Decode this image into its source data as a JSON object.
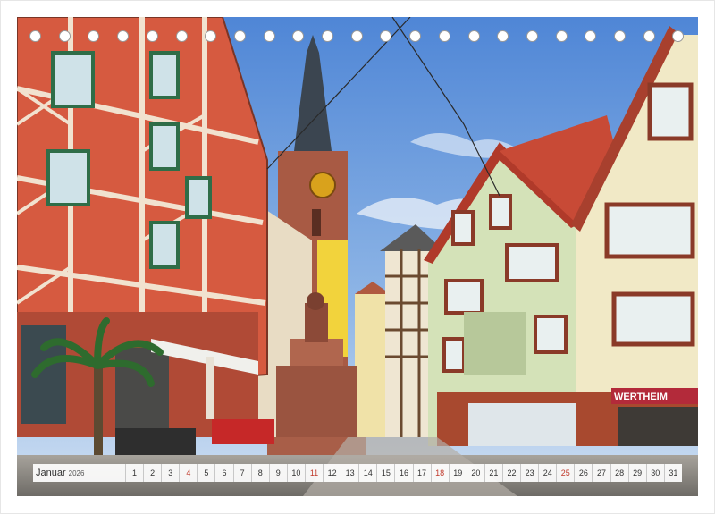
{
  "calendar": {
    "month": "Januar",
    "year": "2026",
    "days": [
      "1",
      "2",
      "3",
      "4",
      "5",
      "6",
      "7",
      "8",
      "9",
      "10",
      "11",
      "12",
      "13",
      "14",
      "15",
      "16",
      "17",
      "18",
      "19",
      "20",
      "21",
      "22",
      "23",
      "24",
      "25",
      "26",
      "27",
      "28",
      "29",
      "30",
      "31"
    ],
    "sunday_days": [
      "4",
      "11",
      "18",
      "25"
    ],
    "weekend_color": "#c0392b"
  },
  "shop_sign": {
    "text": "WERTHEIM"
  },
  "ring_holes": {
    "count": 23
  },
  "colors": {
    "sky": "#5f93d8",
    "frame_red": "#c9553f",
    "tower_yellow": "#f2d33c",
    "cobblestone": "#8a8a8a"
  }
}
